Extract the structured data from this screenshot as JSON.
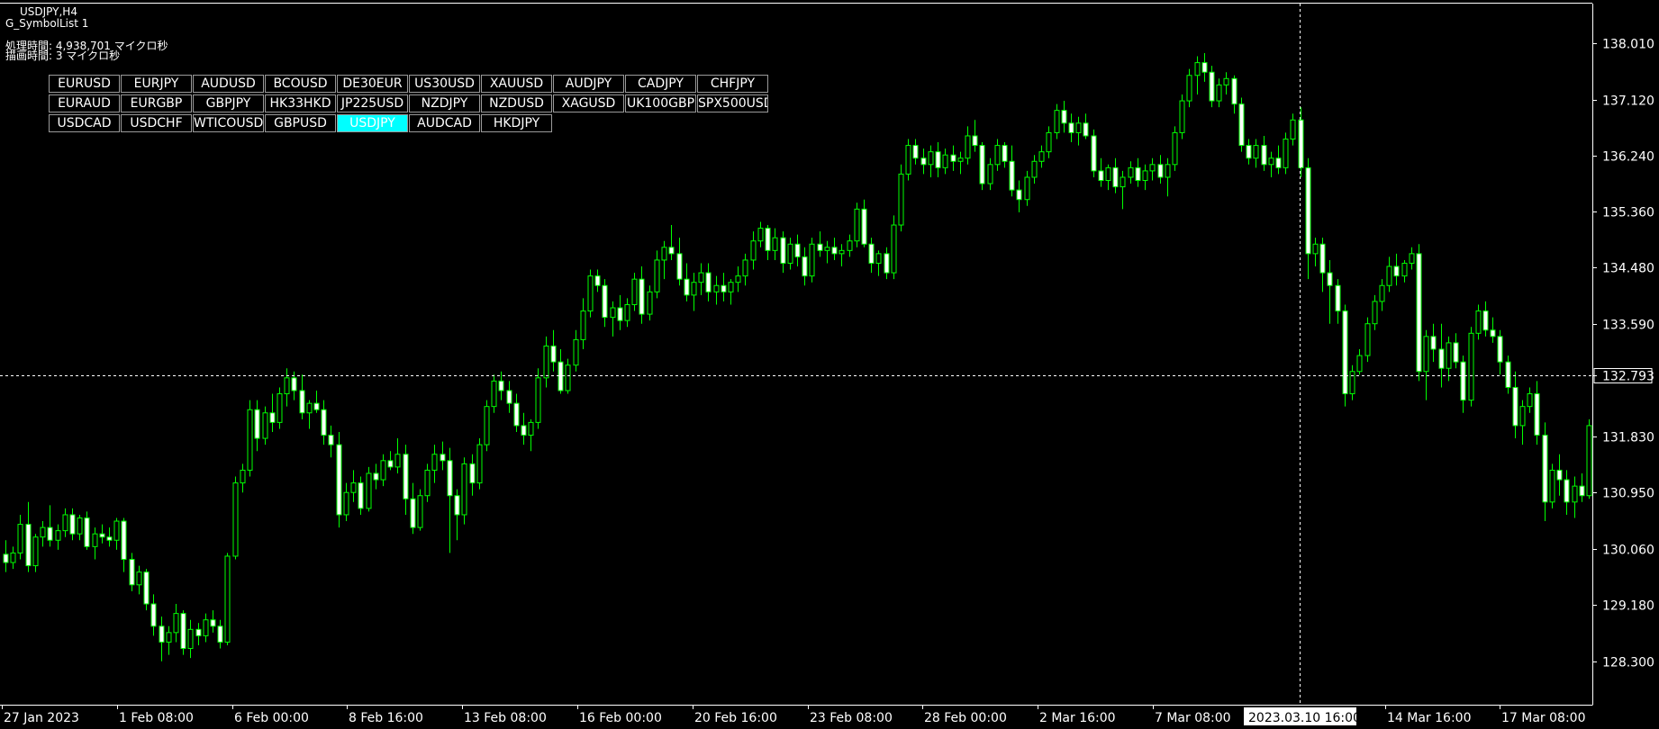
{
  "header": {
    "symbol_timeframe": "USDJPY,H4",
    "indicator_name": "G_SymbolList 1",
    "processing_time": "処理時間: 4,938,701 マイクロ秒",
    "drawing_time": "描画時間: 3 マイクロ秒"
  },
  "symbols": {
    "rows": [
      [
        "EURUSD",
        "EURJPY",
        "AUDUSD",
        "BCOUSD",
        "DE30EUR",
        "US30USD",
        "XAUUSD",
        "AUDJPY",
        "CADJPY",
        "CHFJPY"
      ],
      [
        "EURAUD",
        "EURGBP",
        "GBPJPY",
        "HK33HKD",
        "JP225USD",
        "NZDJPY",
        "NZDUSD",
        "XAGUSD",
        "UK100GBP",
        "SPX500USD"
      ],
      [
        "USDCAD",
        "USDCHF",
        "WTICOUSD",
        "GBPUSD",
        "USDJPY",
        "AUDCAD",
        "HKDJPY"
      ]
    ],
    "active": "USDJPY",
    "active_color": "#00ffff"
  },
  "colors": {
    "background": "#000000",
    "candle_outline": "#00ff00",
    "bull_body": "#000000",
    "bear_body": "#ffffff",
    "axis": "#ffffff",
    "crosshair": "#ffffff"
  },
  "chart_data": {
    "type": "candlestick",
    "symbol": "USDJPY",
    "timeframe": "H4",
    "ylim": [
      127.9,
      138.5
    ],
    "y_ticks": [
      "138.010",
      "137.120",
      "136.240",
      "135.360",
      "134.480",
      "133.590",
      "132.793",
      "131.830",
      "130.950",
      "130.060",
      "129.180",
      "128.300"
    ],
    "x_ticks": [
      "27 Jan 2023",
      "1 Feb 08:00",
      "6 Feb 00:00",
      "8 Feb 16:00",
      "13 Feb 08:00",
      "16 Feb 00:00",
      "20 Feb 16:00",
      "23 Feb 08:00",
      "28 Feb 00:00",
      "2 Mar 16:00",
      "7 Mar 08:00",
      "2023.03.10 16:00",
      "14 Mar 16:00",
      "17 Mar 08:00"
    ],
    "crosshair": {
      "price": "132.793",
      "time": "2023.03.10 16:00"
    },
    "ohlc": [
      [
        129.98,
        130.2,
        129.7,
        129.85
      ],
      [
        129.85,
        130.1,
        129.75,
        130.0
      ],
      [
        130.0,
        130.6,
        129.9,
        130.45
      ],
      [
        130.45,
        130.8,
        129.7,
        129.8
      ],
      [
        129.8,
        130.3,
        129.7,
        130.25
      ],
      [
        130.25,
        130.5,
        130.1,
        130.4
      ],
      [
        130.4,
        130.75,
        130.1,
        130.2
      ],
      [
        130.2,
        130.45,
        130.05,
        130.35
      ],
      [
        130.35,
        130.7,
        130.25,
        130.6
      ],
      [
        130.6,
        130.7,
        130.2,
        130.3
      ],
      [
        130.3,
        130.6,
        130.2,
        130.55
      ],
      [
        130.55,
        130.65,
        130.05,
        130.1
      ],
      [
        130.1,
        130.4,
        129.9,
        130.3
      ],
      [
        130.3,
        130.45,
        130.15,
        130.25
      ],
      [
        130.25,
        130.4,
        130.1,
        130.2
      ],
      [
        130.2,
        130.55,
        130.05,
        130.5
      ],
      [
        130.5,
        130.55,
        129.7,
        129.9
      ],
      [
        129.9,
        130.0,
        129.4,
        129.5
      ],
      [
        129.5,
        129.8,
        129.35,
        129.7
      ],
      [
        129.7,
        129.75,
        129.1,
        129.2
      ],
      [
        129.2,
        129.35,
        128.7,
        128.85
      ],
      [
        128.85,
        129.0,
        128.3,
        128.6
      ],
      [
        128.6,
        128.85,
        128.4,
        128.75
      ],
      [
        128.75,
        129.2,
        128.6,
        129.05
      ],
      [
        129.05,
        129.1,
        128.4,
        128.5
      ],
      [
        128.5,
        128.95,
        128.35,
        128.8
      ],
      [
        128.8,
        128.9,
        128.55,
        128.7
      ],
      [
        128.7,
        129.05,
        128.6,
        128.95
      ],
      [
        128.95,
        129.1,
        128.75,
        128.85
      ],
      [
        128.85,
        128.95,
        128.5,
        128.6
      ],
      [
        128.6,
        130.0,
        128.55,
        129.95
      ],
      [
        129.95,
        131.2,
        129.9,
        131.1
      ],
      [
        131.1,
        131.4,
        130.95,
        131.3
      ],
      [
        131.3,
        132.4,
        131.2,
        132.25
      ],
      [
        132.25,
        132.4,
        131.6,
        131.8
      ],
      [
        131.8,
        132.3,
        131.7,
        132.2
      ],
      [
        132.2,
        132.5,
        131.9,
        132.05
      ],
      [
        132.05,
        132.6,
        131.95,
        132.5
      ],
      [
        132.5,
        132.9,
        132.3,
        132.75
      ],
      [
        132.75,
        132.85,
        132.4,
        132.55
      ],
      [
        132.55,
        132.8,
        132.1,
        132.2
      ],
      [
        132.2,
        132.4,
        131.95,
        132.35
      ],
      [
        132.35,
        132.55,
        132.2,
        132.25
      ],
      [
        132.25,
        132.4,
        131.7,
        131.85
      ],
      [
        131.85,
        132.0,
        131.5,
        131.7
      ],
      [
        131.7,
        131.9,
        130.4,
        130.6
      ],
      [
        130.6,
        131.1,
        130.5,
        130.95
      ],
      [
        130.95,
        131.3,
        130.8,
        131.1
      ],
      [
        131.1,
        131.2,
        130.6,
        130.7
      ],
      [
        130.7,
        131.35,
        130.65,
        131.25
      ],
      [
        131.25,
        131.4,
        131.0,
        131.15
      ],
      [
        131.15,
        131.55,
        131.05,
        131.45
      ],
      [
        131.45,
        131.6,
        131.3,
        131.35
      ],
      [
        131.35,
        131.8,
        131.25,
        131.55
      ],
      [
        131.55,
        131.7,
        130.6,
        130.85
      ],
      [
        130.85,
        131.1,
        130.3,
        130.4
      ],
      [
        130.4,
        131.0,
        130.35,
        130.9
      ],
      [
        130.9,
        131.4,
        130.8,
        131.3
      ],
      [
        131.3,
        131.7,
        131.1,
        131.55
      ],
      [
        131.55,
        131.75,
        131.3,
        131.45
      ],
      [
        131.45,
        131.65,
        130.0,
        130.9
      ],
      [
        130.9,
        131.0,
        130.2,
        130.6
      ],
      [
        130.6,
        131.5,
        130.45,
        131.4
      ],
      [
        131.4,
        131.55,
        130.9,
        131.1
      ],
      [
        131.1,
        131.8,
        131.0,
        131.7
      ],
      [
        131.7,
        132.4,
        131.6,
        132.3
      ],
      [
        132.3,
        132.8,
        132.2,
        132.7
      ],
      [
        132.7,
        132.85,
        132.4,
        132.55
      ],
      [
        132.55,
        132.7,
        132.2,
        132.35
      ],
      [
        132.35,
        132.5,
        131.9,
        132.0
      ],
      [
        132.0,
        132.2,
        131.7,
        131.85
      ],
      [
        131.85,
        132.1,
        131.6,
        132.05
      ],
      [
        132.05,
        132.9,
        131.95,
        132.75
      ],
      [
        132.75,
        133.4,
        132.6,
        133.25
      ],
      [
        133.25,
        133.5,
        132.85,
        133.0
      ],
      [
        133.0,
        133.2,
        132.5,
        132.55
      ],
      [
        132.55,
        133.05,
        132.5,
        132.95
      ],
      [
        132.95,
        133.5,
        132.85,
        133.35
      ],
      [
        133.35,
        134.0,
        133.2,
        133.8
      ],
      [
        133.8,
        134.45,
        133.7,
        134.35
      ],
      [
        134.35,
        134.45,
        134.1,
        134.2
      ],
      [
        134.2,
        134.3,
        133.55,
        133.7
      ],
      [
        133.7,
        133.95,
        133.4,
        133.85
      ],
      [
        133.85,
        134.05,
        133.5,
        133.65
      ],
      [
        133.65,
        134.0,
        133.55,
        133.9
      ],
      [
        133.9,
        134.4,
        133.8,
        134.3
      ],
      [
        134.3,
        134.5,
        133.6,
        133.75
      ],
      [
        133.75,
        134.2,
        133.65,
        134.1
      ],
      [
        134.1,
        134.75,
        134.0,
        134.6
      ],
      [
        134.6,
        134.9,
        134.3,
        134.8
      ],
      [
        134.8,
        135.15,
        134.6,
        134.7
      ],
      [
        134.7,
        134.95,
        134.2,
        134.3
      ],
      [
        134.3,
        134.55,
        133.95,
        134.05
      ],
      [
        134.05,
        134.4,
        133.8,
        134.25
      ],
      [
        134.25,
        134.55,
        134.05,
        134.4
      ],
      [
        134.4,
        134.55,
        133.95,
        134.1
      ],
      [
        134.1,
        134.35,
        133.9,
        134.2
      ],
      [
        134.2,
        134.4,
        133.95,
        134.1
      ],
      [
        134.1,
        134.3,
        133.9,
        134.25
      ],
      [
        134.25,
        134.5,
        134.1,
        134.35
      ],
      [
        134.35,
        134.7,
        134.2,
        134.6
      ],
      [
        134.6,
        135.05,
        134.45,
        134.9
      ],
      [
        134.9,
        135.2,
        134.8,
        135.1
      ],
      [
        135.1,
        135.15,
        134.6,
        134.75
      ],
      [
        134.75,
        135.1,
        134.6,
        134.95
      ],
      [
        134.95,
        135.05,
        134.4,
        134.55
      ],
      [
        134.55,
        134.95,
        134.45,
        134.85
      ],
      [
        134.85,
        135.0,
        134.5,
        134.65
      ],
      [
        134.65,
        134.8,
        134.2,
        134.35
      ],
      [
        134.35,
        134.95,
        134.25,
        134.85
      ],
      [
        134.85,
        135.05,
        134.65,
        134.75
      ],
      [
        134.75,
        134.9,
        134.55,
        134.8
      ],
      [
        134.8,
        134.95,
        134.6,
        134.7
      ],
      [
        134.7,
        134.85,
        134.5,
        134.75
      ],
      [
        134.75,
        135.0,
        134.65,
        134.9
      ],
      [
        134.9,
        135.5,
        134.8,
        135.4
      ],
      [
        135.4,
        135.55,
        134.8,
        134.85
      ],
      [
        134.85,
        134.95,
        134.4,
        134.55
      ],
      [
        134.55,
        134.75,
        134.35,
        134.7
      ],
      [
        134.7,
        134.8,
        134.3,
        134.4
      ],
      [
        134.4,
        135.3,
        134.3,
        135.15
      ],
      [
        135.15,
        136.1,
        135.05,
        135.95
      ],
      [
        135.95,
        136.5,
        135.85,
        136.4
      ],
      [
        136.4,
        136.5,
        136.1,
        136.2
      ],
      [
        136.2,
        136.35,
        135.95,
        136.1
      ],
      [
        136.1,
        136.4,
        135.9,
        136.3
      ],
      [
        136.3,
        136.45,
        135.9,
        136.05
      ],
      [
        136.05,
        136.35,
        135.95,
        136.25
      ],
      [
        136.25,
        136.4,
        136.0,
        136.15
      ],
      [
        136.15,
        136.3,
        135.95,
        136.2
      ],
      [
        136.2,
        136.7,
        136.1,
        136.55
      ],
      [
        136.55,
        136.8,
        136.3,
        136.4
      ],
      [
        136.4,
        136.45,
        135.7,
        135.8
      ],
      [
        135.8,
        136.2,
        135.7,
        136.1
      ],
      [
        136.1,
        136.5,
        136.0,
        136.4
      ],
      [
        136.4,
        136.45,
        136.05,
        136.15
      ],
      [
        136.15,
        136.4,
        135.6,
        135.7
      ],
      [
        135.7,
        135.85,
        135.35,
        135.55
      ],
      [
        135.55,
        136.0,
        135.45,
        135.9
      ],
      [
        135.9,
        136.25,
        135.8,
        136.15
      ],
      [
        136.15,
        136.4,
        136.05,
        136.3
      ],
      [
        136.3,
        136.7,
        136.2,
        136.6
      ],
      [
        136.6,
        137.05,
        136.5,
        136.95
      ],
      [
        136.95,
        137.1,
        136.6,
        136.75
      ],
      [
        136.75,
        136.9,
        136.45,
        136.6
      ],
      [
        136.6,
        136.85,
        136.4,
        136.75
      ],
      [
        136.75,
        136.9,
        136.5,
        136.55
      ],
      [
        136.55,
        136.65,
        135.9,
        136.0
      ],
      [
        136.0,
        136.2,
        135.75,
        135.85
      ],
      [
        135.85,
        136.1,
        135.7,
        136.05
      ],
      [
        136.05,
        136.2,
        135.65,
        135.75
      ],
      [
        135.75,
        136.0,
        135.4,
        135.9
      ],
      [
        135.9,
        136.15,
        135.8,
        136.05
      ],
      [
        136.05,
        136.2,
        135.75,
        135.85
      ],
      [
        135.85,
        136.1,
        135.7,
        136.0
      ],
      [
        136.0,
        136.2,
        135.85,
        136.1
      ],
      [
        136.1,
        136.25,
        135.8,
        135.9
      ],
      [
        135.9,
        136.2,
        135.6,
        136.1
      ],
      [
        136.1,
        136.7,
        136.0,
        136.6
      ],
      [
        136.6,
        137.2,
        136.5,
        137.1
      ],
      [
        137.1,
        137.6,
        137.0,
        137.5
      ],
      [
        137.5,
        137.8,
        137.2,
        137.7
      ],
      [
        137.7,
        137.85,
        137.4,
        137.55
      ],
      [
        137.55,
        137.65,
        137.0,
        137.1
      ],
      [
        137.1,
        137.45,
        137.0,
        137.35
      ],
      [
        137.35,
        137.55,
        137.2,
        137.45
      ],
      [
        137.45,
        137.5,
        136.9,
        137.05
      ],
      [
        137.05,
        137.15,
        136.3,
        136.4
      ],
      [
        136.4,
        136.5,
        136.1,
        136.2
      ],
      [
        136.2,
        136.5,
        136.05,
        136.4
      ],
      [
        136.4,
        136.55,
        136.0,
        136.1
      ],
      [
        136.1,
        136.3,
        135.9,
        136.2
      ],
      [
        136.2,
        136.4,
        135.95,
        136.05
      ],
      [
        136.05,
        136.6,
        135.95,
        136.5
      ],
      [
        136.5,
        136.9,
        136.4,
        136.8
      ],
      [
        136.8,
        137.0,
        135.9,
        136.05
      ],
      [
        136.05,
        136.2,
        134.3,
        134.7
      ],
      [
        134.7,
        134.95,
        134.5,
        134.85
      ],
      [
        134.85,
        134.95,
        134.1,
        134.4
      ],
      [
        134.4,
        134.6,
        133.6,
        134.2
      ],
      [
        134.2,
        134.3,
        133.6,
        133.8
      ],
      [
        133.8,
        133.9,
        132.3,
        132.5
      ],
      [
        132.5,
        132.95,
        132.4,
        132.85
      ],
      [
        132.85,
        133.2,
        132.8,
        133.1
      ],
      [
        133.1,
        133.7,
        133.0,
        133.6
      ],
      [
        133.6,
        134.05,
        133.5,
        133.95
      ],
      [
        133.95,
        134.3,
        133.8,
        134.2
      ],
      [
        134.2,
        134.65,
        134.1,
        134.5
      ],
      [
        134.5,
        134.7,
        134.2,
        134.35
      ],
      [
        134.35,
        134.6,
        134.25,
        134.55
      ],
      [
        134.55,
        134.8,
        134.45,
        134.7
      ],
      [
        134.7,
        134.85,
        132.7,
        132.85
      ],
      [
        132.85,
        133.5,
        132.4,
        133.4
      ],
      [
        133.4,
        133.6,
        133.0,
        133.2
      ],
      [
        133.2,
        133.6,
        132.6,
        132.9
      ],
      [
        132.9,
        133.4,
        132.7,
        133.3
      ],
      [
        133.3,
        133.45,
        132.9,
        133.0
      ],
      [
        133.0,
        133.1,
        132.2,
        132.4
      ],
      [
        132.4,
        133.55,
        132.3,
        133.45
      ],
      [
        133.45,
        133.9,
        133.35,
        133.8
      ],
      [
        133.8,
        133.95,
        133.4,
        133.5
      ],
      [
        133.5,
        133.7,
        133.3,
        133.4
      ],
      [
        133.4,
        133.5,
        132.8,
        133.0
      ],
      [
        133.0,
        133.1,
        132.5,
        132.6
      ],
      [
        132.6,
        132.85,
        131.8,
        132.0
      ],
      [
        132.0,
        132.4,
        131.7,
        132.3
      ],
      [
        132.3,
        132.6,
        132.2,
        132.5
      ],
      [
        132.5,
        132.7,
        131.7,
        131.85
      ],
      [
        131.85,
        132.05,
        130.5,
        130.8
      ],
      [
        130.8,
        131.4,
        130.7,
        131.3
      ],
      [
        131.3,
        131.55,
        130.9,
        131.15
      ],
      [
        131.15,
        131.3,
        130.6,
        130.8
      ],
      [
        130.8,
        131.2,
        130.55,
        131.05
      ],
      [
        131.05,
        131.25,
        130.8,
        130.9
      ],
      [
        130.9,
        132.1,
        130.85,
        132.0
      ]
    ]
  }
}
